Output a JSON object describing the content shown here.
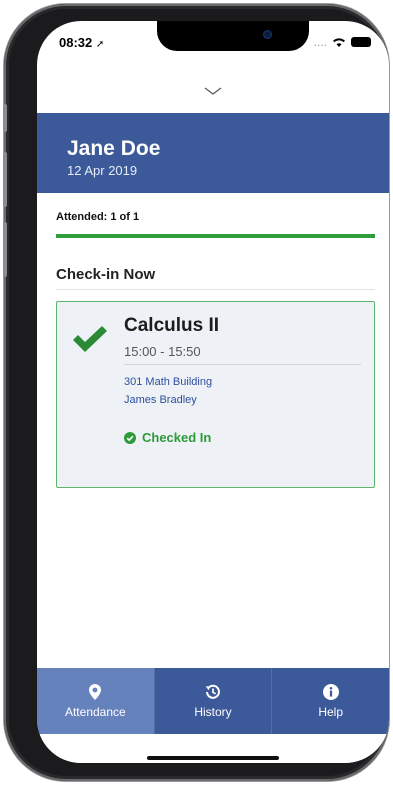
{
  "status_bar": {
    "time": "08:32",
    "signal_dots": "...."
  },
  "header": {
    "name": "Jane Doe",
    "date": "12 Apr 2019"
  },
  "attendance": {
    "label": "Attended: 1 of 1",
    "progress": 1.0
  },
  "section": {
    "title": "Check-in Now"
  },
  "class_card": {
    "course": "Calculus II",
    "time": "15:00 - 15:50",
    "room": "301 Math Building",
    "teacher": "James Bradley",
    "status": "Checked In"
  },
  "tabs": [
    {
      "label": "Attendance",
      "icon": "location-pin-icon",
      "active": true
    },
    {
      "label": "History",
      "icon": "history-icon",
      "active": false
    },
    {
      "label": "Help",
      "icon": "info-icon",
      "active": false
    }
  ],
  "colors": {
    "brand": "#3c5a99",
    "active_tab": "#6582bd",
    "success": "#2f9e3b",
    "link": "#2e4f9d"
  }
}
